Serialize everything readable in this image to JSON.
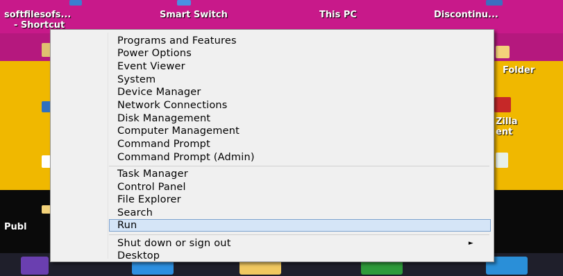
{
  "desktop": {
    "icons": [
      {
        "label": "softfilesofs...",
        "label2": "- Shortcut"
      },
      {
        "label": "Smart Switch"
      },
      {
        "label": "This PC"
      },
      {
        "label": "Discontinu..."
      },
      {
        "label": "Folder"
      },
      {
        "label": "Zilla"
      },
      {
        "label": "ent"
      },
      {
        "label": "Publ"
      }
    ]
  },
  "menu": {
    "items": [
      {
        "label": "Programs and Features"
      },
      {
        "label": "Power Options"
      },
      {
        "label": "Event Viewer"
      },
      {
        "label": "System"
      },
      {
        "label": "Device Manager"
      },
      {
        "label": "Network Connections"
      },
      {
        "label": "Disk Management"
      },
      {
        "label": "Computer Management"
      },
      {
        "label": "Command Prompt"
      },
      {
        "label": "Command Prompt (Admin)"
      },
      {
        "label": "Task Manager"
      },
      {
        "label": "Control Panel"
      },
      {
        "label": "File Explorer"
      },
      {
        "label": "Search"
      },
      {
        "label": "Run"
      },
      {
        "label": "Shut down or sign out"
      },
      {
        "label": "Desktop"
      }
    ],
    "submenu_arrow": "►",
    "highlighted": "Run"
  },
  "colors": {
    "desktop_magenta": "#c8198a",
    "desktop_yellow": "#f0b800",
    "highlight_bg": "#d5e5f7",
    "highlight_border": "#7da2ce"
  }
}
